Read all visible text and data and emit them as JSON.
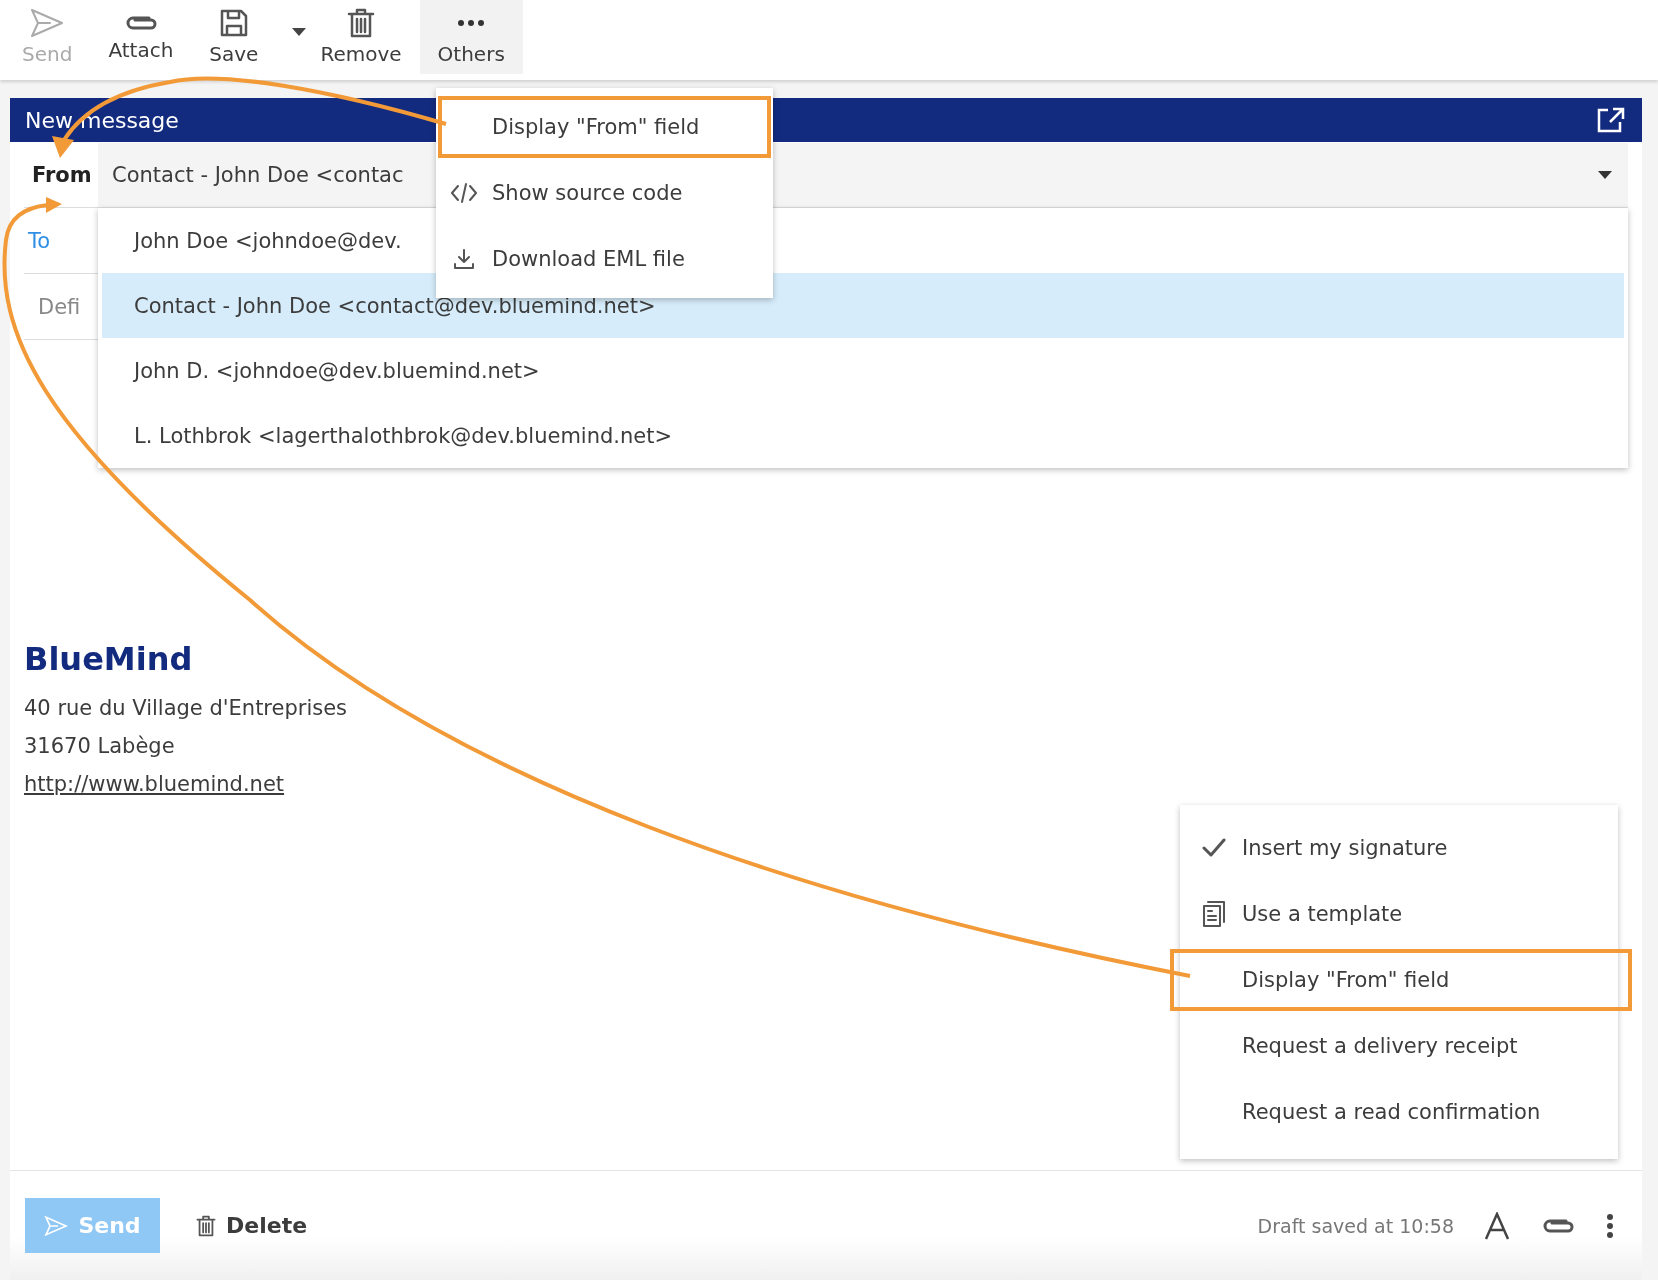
{
  "toolbar": [
    {
      "kind": "send",
      "label": "Send",
      "disabled": true,
      "selected": false
    },
    {
      "kind": "attach",
      "label": "Attach",
      "disabled": false,
      "selected": false
    },
    {
      "kind": "save",
      "label": "Save",
      "disabled": false,
      "selected": false,
      "dropdown": true
    },
    {
      "kind": "remove",
      "label": "Remove",
      "disabled": false,
      "selected": false
    },
    {
      "kind": "others",
      "label": "Others",
      "disabled": false,
      "selected": true
    }
  ],
  "compose": {
    "title": "New message",
    "from_label": "From",
    "from_value": "Contact - John Doe <contac",
    "to_label": "To",
    "subject_placeholder": "Defi"
  },
  "from_options": [
    {
      "label": "John Doe <johndoe@dev.",
      "selected": false
    },
    {
      "label": "Contact - John Doe <contact@dev.bluemind.net>",
      "selected": true
    },
    {
      "label": "John D. <johndoe@dev.bluemind.net>",
      "selected": false
    },
    {
      "label": "L. Lothbrok <lagerthalothbrok@dev.bluemind.net>",
      "selected": false
    }
  ],
  "others_menu": [
    {
      "kind": "plain",
      "label": "Display \"From\" field",
      "highlighted": true
    },
    {
      "kind": "code",
      "label": "Show source code",
      "highlighted": false
    },
    {
      "kind": "download",
      "label": "Download EML file",
      "highlighted": false
    }
  ],
  "signature": {
    "company": "BlueMind",
    "lines": [
      "40 rue du Village d'Entreprises",
      "31670 Labège"
    ],
    "link": "http://www.bluemind.net"
  },
  "options_menu": [
    {
      "kind": "toggle",
      "label": "Insert my signature",
      "checked": true,
      "highlighted": false
    },
    {
      "kind": "template",
      "label": "Use a template",
      "highlighted": false
    },
    {
      "kind": "toggle",
      "label": "Display \"From\" field",
      "checked": false,
      "highlighted": true
    },
    {
      "kind": "toggle",
      "label": "Request a delivery receipt",
      "checked": false,
      "highlighted": false
    },
    {
      "kind": "toggle",
      "label": "Request a read confirmation",
      "checked": false,
      "highlighted": false
    }
  ],
  "footer": {
    "send": "Send",
    "delete": "Delete",
    "status": "Draft saved at 10:58"
  }
}
